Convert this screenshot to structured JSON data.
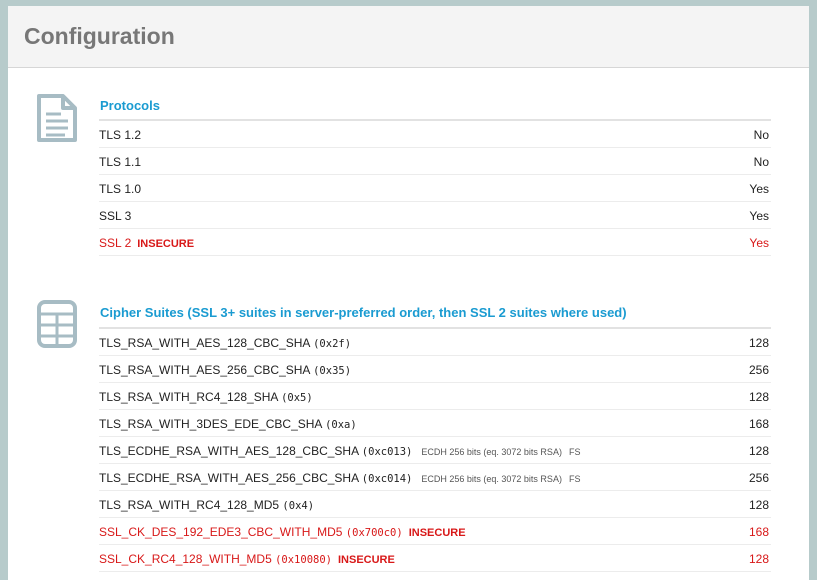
{
  "page": {
    "title": "Configuration"
  },
  "protocols": {
    "title": "Protocols",
    "icon": "document-icon",
    "rows": [
      {
        "name": "TLS 1.2",
        "tag": "",
        "value": "No"
      },
      {
        "name": "TLS 1.1",
        "tag": "",
        "value": "No"
      },
      {
        "name": "TLS 1.0",
        "tag": "",
        "value": "Yes"
      },
      {
        "name": "SSL 3",
        "tag": "",
        "value": "Yes"
      },
      {
        "name": "SSL 2",
        "tag": "INSECURE",
        "value": "Yes"
      }
    ]
  },
  "ciphers": {
    "title": "Cipher Suites (SSL 3+ suites in server-preferred order, then SSL 2 suites where used)",
    "icon": "table-icon",
    "rows": [
      {
        "name": "TLS_RSA_WITH_AES_128_CBC_SHA",
        "code": "(0x2f)",
        "note": "",
        "fs": "",
        "tag": "",
        "value": "128"
      },
      {
        "name": "TLS_RSA_WITH_AES_256_CBC_SHA",
        "code": "(0x35)",
        "note": "",
        "fs": "",
        "tag": "",
        "value": "256"
      },
      {
        "name": "TLS_RSA_WITH_RC4_128_SHA",
        "code": "(0x5)",
        "note": "",
        "fs": "",
        "tag": "",
        "value": "128"
      },
      {
        "name": "TLS_RSA_WITH_3DES_EDE_CBC_SHA",
        "code": "(0xa)",
        "note": "",
        "fs": "",
        "tag": "",
        "value": "168"
      },
      {
        "name": "TLS_ECDHE_RSA_WITH_AES_128_CBC_SHA",
        "code": "(0xc013)",
        "note": "ECDH 256 bits (eq. 3072 bits RSA)",
        "fs": "FS",
        "tag": "",
        "value": "128"
      },
      {
        "name": "TLS_ECDHE_RSA_WITH_AES_256_CBC_SHA",
        "code": "(0xc014)",
        "note": "ECDH 256 bits (eq. 3072 bits RSA)",
        "fs": "FS",
        "tag": "",
        "value": "256"
      },
      {
        "name": "TLS_RSA_WITH_RC4_128_MD5",
        "code": "(0x4)",
        "note": "",
        "fs": "",
        "tag": "",
        "value": "128"
      },
      {
        "name": "SSL_CK_DES_192_EDE3_CBC_WITH_MD5",
        "code": "(0x700c0)",
        "note": "",
        "fs": "",
        "tag": "INSECURE",
        "value": "168"
      },
      {
        "name": "SSL_CK_RC4_128_WITH_MD5",
        "code": "(0x10080)",
        "note": "",
        "fs": "",
        "tag": "INSECURE",
        "value": "128"
      }
    ]
  },
  "colors": {
    "accent": "#1a9bd1",
    "insecure": "#d81818",
    "frame": "#b7cbcb",
    "header_text": "#777777"
  }
}
